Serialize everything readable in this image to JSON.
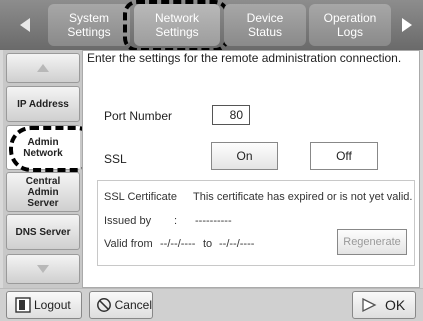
{
  "tabs": {
    "system_settings": "System\nSettings",
    "network_settings": "Network\nSettings",
    "device_status": "Device\nStatus",
    "operation_logs": "Operation\nLogs"
  },
  "sidebar": {
    "items": [
      {
        "label": "IP Address"
      },
      {
        "label": "Admin\nNetwork"
      },
      {
        "label": "Central\nAdmin\nServer"
      },
      {
        "label": "DNS Server"
      }
    ]
  },
  "main": {
    "instruction": "Enter the settings for the remote administration connection.",
    "port_label": "Port Number",
    "port_value": "80",
    "ssl_label": "SSL",
    "ssl_on": "On",
    "ssl_off": "Off",
    "cert_label": "SSL Certificate",
    "cert_status": "This certificate has expired or is not yet valid.",
    "issued_by_label": "Issued by",
    "issued_by_sep": ":",
    "issued_by_value": "----------",
    "valid_from_label": "Valid from",
    "valid_from_value": "--/--/----",
    "valid_to_label": "to",
    "valid_to_value": "--/--/----",
    "regenerate": "Regenerate"
  },
  "bottom": {
    "logout": "Logout",
    "cancel": "Cancel",
    "ok": "OK"
  }
}
